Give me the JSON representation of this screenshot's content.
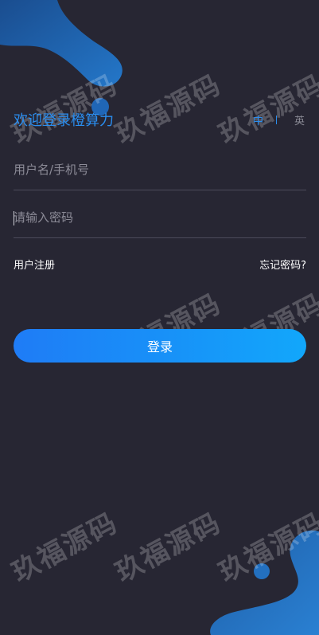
{
  "header": {
    "title": "欢迎登录橙算力",
    "lang_zh": "中",
    "lang_en": "英"
  },
  "form": {
    "username_placeholder": "用户名/手机号",
    "password_placeholder": "请输入密码"
  },
  "links": {
    "register": "用户注册",
    "forgot": "忘记密码?"
  },
  "login_button": "登录",
  "watermark_text": "玖福源码",
  "colors": {
    "background": "#272633",
    "accent": "#2a8ef0",
    "button_start": "#1f7cf6",
    "button_end": "#12a7fb"
  }
}
